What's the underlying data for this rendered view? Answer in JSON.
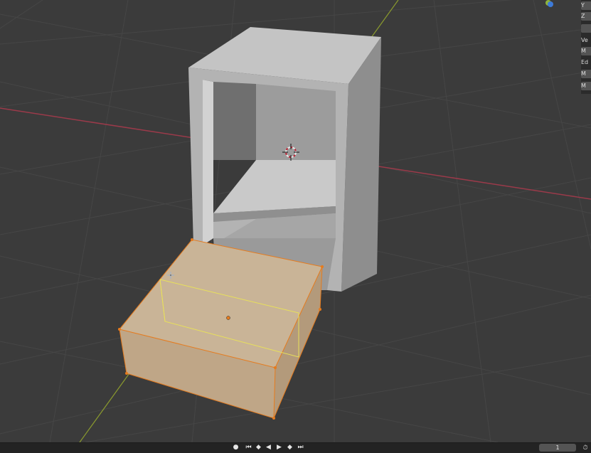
{
  "side_panel": {
    "items": [
      {
        "label": "Y",
        "button": true
      },
      {
        "label": "Z",
        "button": true
      },
      {
        "label": "",
        "button": true
      },
      {
        "label": "Ve",
        "button": false
      },
      {
        "label": "M",
        "button": true
      },
      {
        "label": "Ed",
        "button": false
      },
      {
        "label": "M",
        "button": true
      },
      {
        "label": "M",
        "button": true
      }
    ]
  },
  "timeline": {
    "buttons": [
      {
        "name": "keyframe-dot-icon",
        "glyph": "●"
      },
      {
        "name": "jump-to-start-icon",
        "glyph": "⏮"
      },
      {
        "name": "previous-keyframe-icon",
        "glyph": "◆"
      },
      {
        "name": "play-reverse-icon",
        "glyph": "◀"
      },
      {
        "name": "play-icon",
        "glyph": "▶"
      },
      {
        "name": "next-keyframe-icon",
        "glyph": "◆"
      },
      {
        "name": "jump-to-end-icon",
        "glyph": "⏭"
      }
    ],
    "current_frame": "1",
    "clock_glyph": "⏱"
  },
  "colors": {
    "background": "#3b3b3b",
    "grid": "#474747",
    "x_axis": "#9b3a4a",
    "y_axis": "#8a9a2e",
    "shelf_light": "#b9b9b9",
    "shelf_front": "#9e9e9e",
    "box_top": "#c8b294",
    "box_side": "#b9a182",
    "selection_edge": "#e8e05a",
    "vertex": "#e57b1e"
  }
}
